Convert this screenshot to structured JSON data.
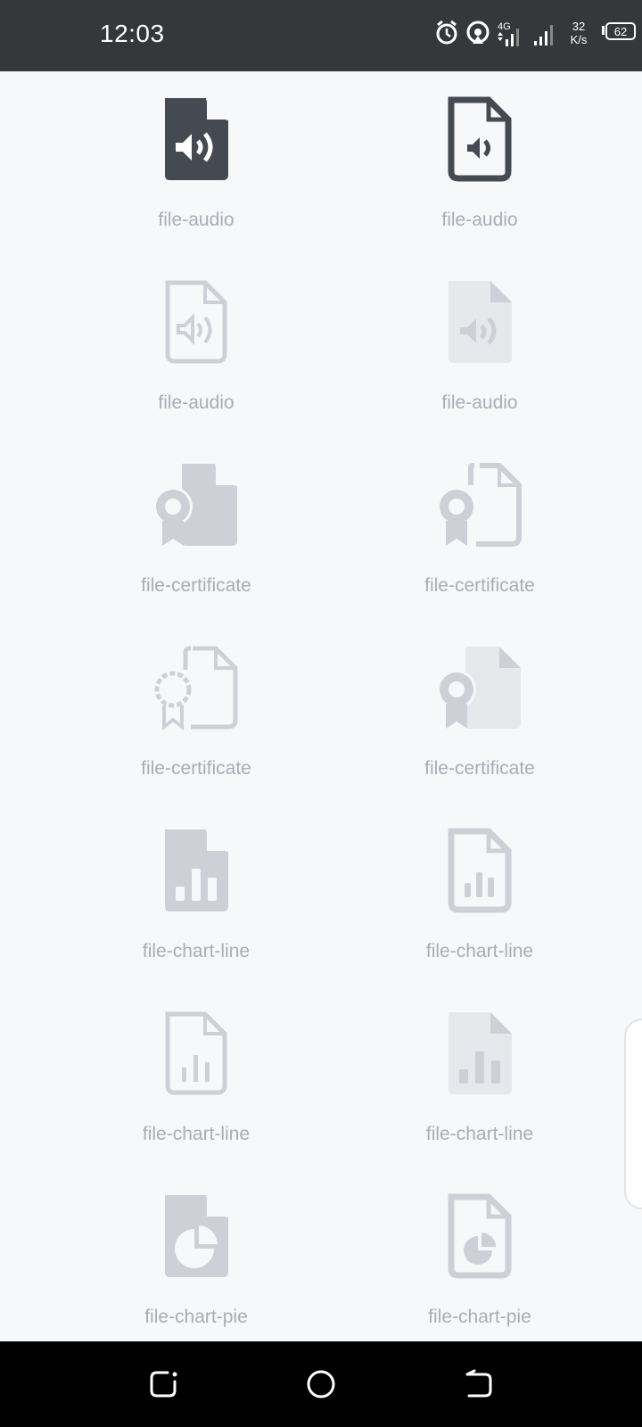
{
  "status_bar": {
    "time": "12:03",
    "speed_value": "32",
    "speed_unit": "K/s",
    "network_type": "4G",
    "battery_level": "62",
    "icons": [
      "alarm-icon",
      "hotspot-icon",
      "signal-4g-icon",
      "signal-icon",
      "battery-icon"
    ]
  },
  "icon_grid": [
    {
      "label": "file-audio",
      "icon": "file-audio-icon",
      "style": "solid",
      "color": "#454a52"
    },
    {
      "label": "file-audio",
      "icon": "file-audio-icon",
      "style": "outline",
      "color": "#454a52"
    },
    {
      "label": "file-audio",
      "icon": "file-audio-icon",
      "style": "outline",
      "color": "#cdd1d7"
    },
    {
      "label": "file-audio",
      "icon": "file-audio-icon",
      "style": "duotone",
      "color": "#cdd1d7"
    },
    {
      "label": "file-certificate",
      "icon": "file-certificate-icon",
      "style": "solid",
      "color": "#cdd1d7"
    },
    {
      "label": "file-certificate",
      "icon": "file-certificate-icon",
      "style": "outline",
      "color": "#cdd1d7"
    },
    {
      "label": "file-certificate",
      "icon": "file-certificate-icon",
      "style": "outline-light",
      "color": "#cdd1d7"
    },
    {
      "label": "file-certificate",
      "icon": "file-certificate-icon",
      "style": "duotone",
      "color": "#cdd1d7"
    },
    {
      "label": "file-chart-line",
      "icon": "file-chart-line-icon",
      "style": "solid",
      "color": "#cdd1d7"
    },
    {
      "label": "file-chart-line",
      "icon": "file-chart-line-icon",
      "style": "outline",
      "color": "#cdd1d7"
    },
    {
      "label": "file-chart-line",
      "icon": "file-chart-line-icon",
      "style": "outline-light",
      "color": "#cdd1d7"
    },
    {
      "label": "file-chart-line",
      "icon": "file-chart-line-icon",
      "style": "duotone",
      "color": "#cdd1d7"
    },
    {
      "label": "file-chart-pie",
      "icon": "file-chart-pie-icon",
      "style": "solid",
      "color": "#cdd1d7"
    },
    {
      "label": "file-chart-pie",
      "icon": "file-chart-pie-icon",
      "style": "outline",
      "color": "#cdd1d7"
    }
  ],
  "nav_bar": {
    "buttons": [
      "recents-icon",
      "home-icon",
      "back-icon"
    ]
  }
}
